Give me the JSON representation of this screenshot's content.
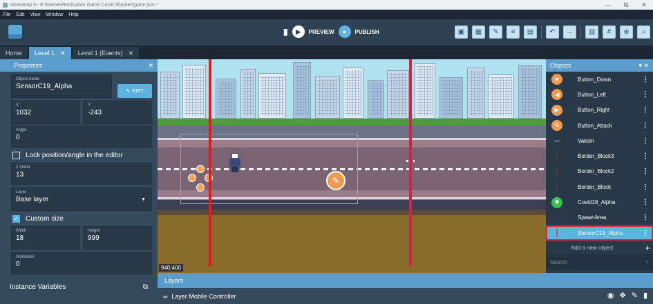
{
  "window": {
    "title": "GDevelop 5 - E:\\Game\\Pembuatan Game Covid Shooter\\game.json *",
    "controls": [
      "—",
      "⧉",
      "✕"
    ]
  },
  "menu": [
    "File",
    "Edit",
    "View",
    "Window",
    "Help"
  ],
  "toolbar": {
    "preview_label": "PREVIEW",
    "publish_label": "PUBLISH",
    "right_icons": [
      "scene-icon",
      "objects-icon",
      "edit-icon",
      "list-icon",
      "events-icon",
      "undo-icon",
      "redo-icon",
      "layers-icon",
      "grid-icon",
      "zoom-icon",
      "more-icon"
    ]
  },
  "tabs": [
    {
      "label": "Home",
      "closable": false,
      "active": false
    },
    {
      "label": "Level 1",
      "closable": true,
      "active": true
    },
    {
      "label": "Level 1 (Events)",
      "closable": true,
      "active": false
    }
  ],
  "properties": {
    "header": "Properties",
    "object_name_label": "Object name",
    "object_name": "SensorC19_Alpha",
    "edit_label": "EDIT",
    "x_label": "X",
    "x_value": "1032",
    "y_label": "Y",
    "y_value": "-243",
    "angle_label": "Angle",
    "angle_value": "0",
    "lock_label": "Lock position/angle in the editor",
    "lock_checked": false,
    "zorder_label": "Z Order",
    "zorder_value": "13",
    "layer_label": "Layer",
    "layer_value": "Base layer",
    "custom_size_label": "Custom size",
    "custom_size_checked": true,
    "width_label": "Width",
    "width_value": "18",
    "height_label": "Height",
    "height_value": "999",
    "animation_label": "Animation",
    "animation_value": "0",
    "instance_variables_label": "Instance Variables"
  },
  "canvas": {
    "coords": "940;400"
  },
  "objects": {
    "header": "Objects",
    "items": [
      {
        "name": "Button_Down",
        "icon": "arrow-down-icon",
        "selected": false
      },
      {
        "name": "Button_Left",
        "icon": "arrow-left-icon",
        "selected": false
      },
      {
        "name": "Button_Right",
        "icon": "arrow-right-icon",
        "selected": false
      },
      {
        "name": "Button_Attack",
        "icon": "pencil-icon",
        "selected": false
      },
      {
        "name": "Vaksin",
        "icon": "syringe-icon",
        "selected": false
      },
      {
        "name": "Border_Block3",
        "icon": "red-bar-icon",
        "selected": false
      },
      {
        "name": "Border_Block2",
        "icon": "red-bar-icon",
        "selected": false
      },
      {
        "name": "Border_Block",
        "icon": "red-bar-icon",
        "selected": false
      },
      {
        "name": "Covid19_Alpha",
        "icon": "virus-icon",
        "selected": false
      },
      {
        "name": "SpawnArea",
        "icon": "spawn-icon",
        "selected": false
      },
      {
        "name": "SensorC19_Alpha",
        "icon": "sensor-icon",
        "selected": true
      }
    ],
    "add_new_label": "Add a new object",
    "search_placeholder": "Search"
  },
  "layers": {
    "header": "Layers",
    "row_label": "Layer Mobile Controller"
  },
  "colors": {
    "accent": "#5a9ccb",
    "panel": "#34495b",
    "selection_outline": "#e0233d",
    "border_red": "#e41b23"
  }
}
